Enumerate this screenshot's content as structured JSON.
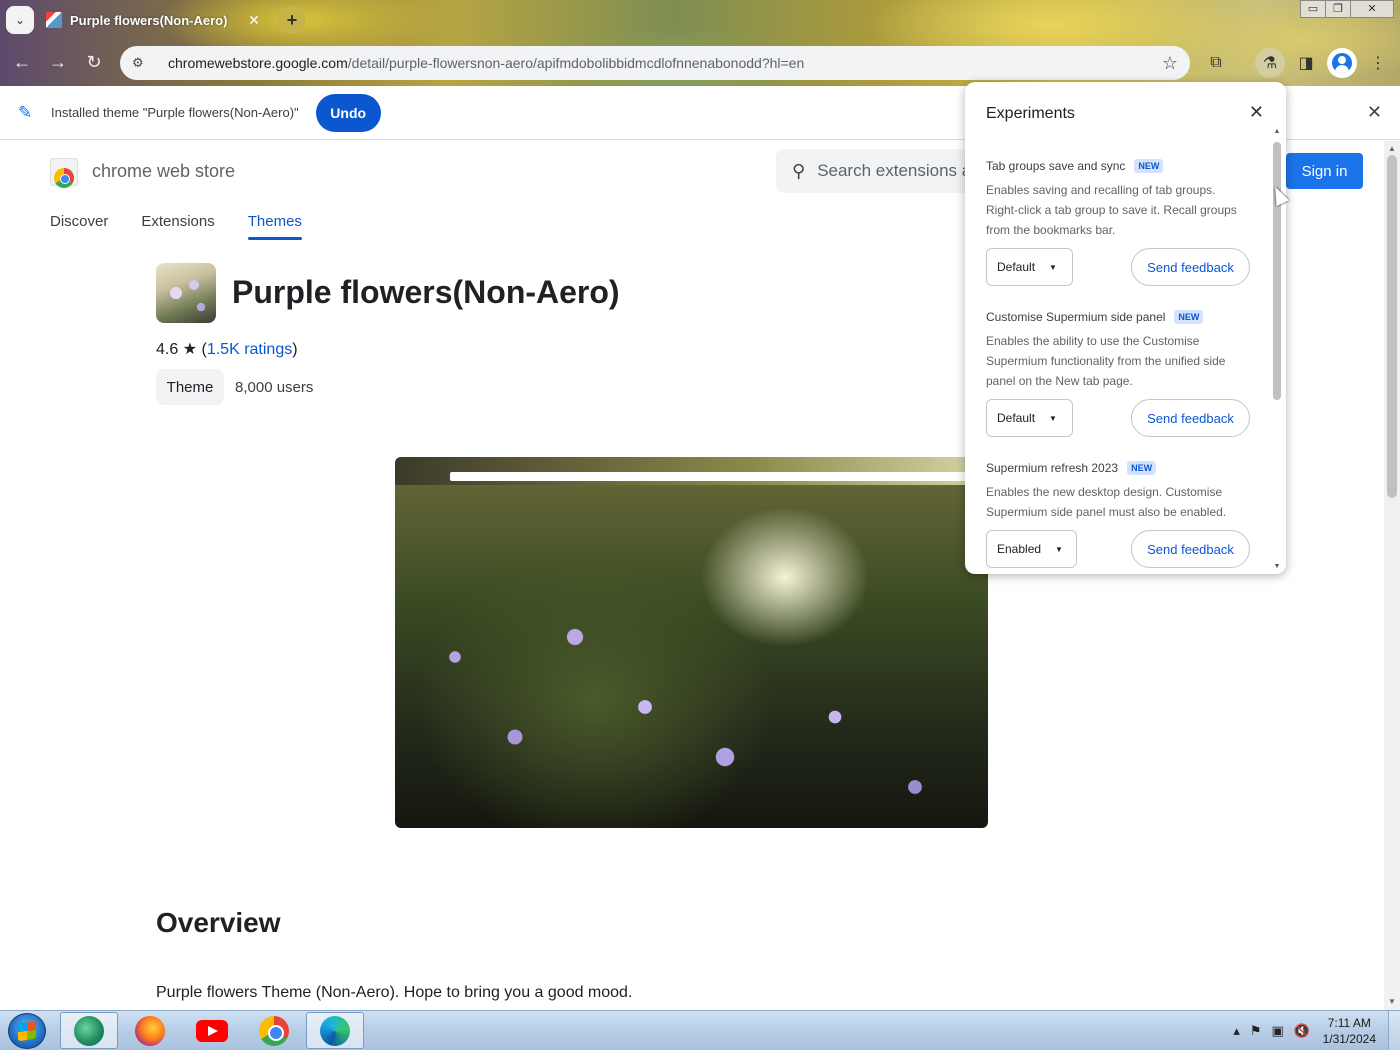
{
  "browser": {
    "tab_title": "Purple flowers(Non-Aero)",
    "tab_close": "✕",
    "new_tab": "+",
    "url_host": "chromewebstore.google.com",
    "url_path": "/detail/purple-flowersnon-aero/apifmdobolibbidmcdlofnnenabonodd?hl=en",
    "window_controls": {
      "minimize": "▭",
      "restore": "❐",
      "close": "✕"
    },
    "nav": {
      "back": "←",
      "forward": "→",
      "reload": "↻"
    }
  },
  "infobar": {
    "message": "Installed theme \"Purple flowers(Non-Aero)\"",
    "undo_label": "Undo",
    "close": "✕"
  },
  "store": {
    "name": "chrome web store",
    "search_placeholder": "Search extensions a",
    "signin_label": "Sign in",
    "tabs": [
      {
        "label": "Discover"
      },
      {
        "label": "Extensions"
      },
      {
        "label": "Themes",
        "active": true
      }
    ]
  },
  "item": {
    "title": "Purple flowers(Non-Aero)",
    "rating_value": "4.6",
    "rating_star": "★",
    "rating_open": " (",
    "rating_link": "1.5K ratings",
    "rating_close": ")",
    "category": "Theme",
    "users": "8,000 users"
  },
  "overview": {
    "heading": "Overview",
    "text": "Purple flowers Theme (Non-Aero). Hope to bring you a good mood."
  },
  "experiments": {
    "title": "Experiments",
    "close": "✕",
    "items": [
      {
        "name": "Tab groups save and sync",
        "badge": "NEW",
        "description": "Enables saving and recalling of tab groups. Right-click a tab group to save it. Recall groups from the bookmarks bar.",
        "select_value": "Default",
        "feedback_label": "Send feedback"
      },
      {
        "name": "Customise Supermium side panel",
        "badge": "NEW",
        "description": "Enables the ability to use the Customise Supermium functionality from the unified side panel on the New tab page.",
        "select_value": "Default",
        "feedback_label": "Send feedback"
      },
      {
        "name": "Supermium refresh 2023",
        "badge": "NEW",
        "description": "Enables the new desktop design. Customise Supermium side panel must also be enabled.",
        "select_value": "Enabled",
        "feedback_label": "Send feedback"
      }
    ]
  },
  "taskbar": {
    "apps": [
      "edge-legacy-icon",
      "firefox-icon",
      "youtube-icon",
      "chrome-icon",
      "edge-icon"
    ],
    "time": "7:11 AM",
    "date": "1/31/2024"
  },
  "colors": {
    "accent": "#0b57d0",
    "signin": "#1a73e8"
  }
}
